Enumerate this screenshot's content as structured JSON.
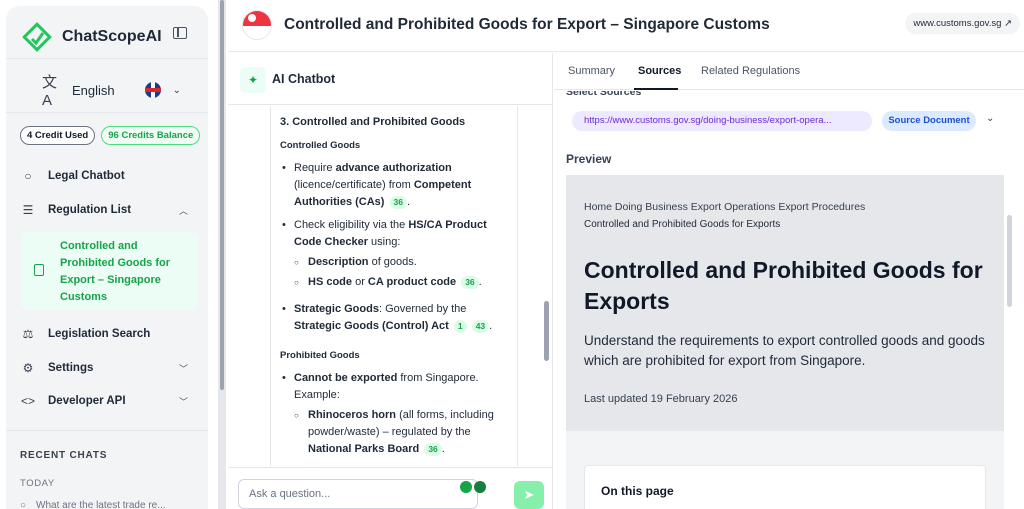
{
  "brand": {
    "name": "ChatScopeAI"
  },
  "language": {
    "label": "English"
  },
  "credits": {
    "used": "4 Credit Used",
    "balance": "96 Credits Balance"
  },
  "nav": {
    "legal_chatbot": "Legal Chatbot",
    "regulation_list": "Regulation List",
    "active_regulation": "Controlled and Prohibited Goods for Export – Singapore Customs",
    "legislation_search": "Legislation Search",
    "settings": "Settings",
    "developer_api": "Developer API"
  },
  "recent": {
    "heading": "RECENT CHATS",
    "today": "TODAY",
    "first_chat": "What are the latest trade re..."
  },
  "header": {
    "title": "Controlled and Prohibited Goods for Export – Singapore Customs",
    "url": "www.customs.gov.sg"
  },
  "chat": {
    "title": "AI Chatbot",
    "section_heading": "3. Controlled and Prohibited Goods",
    "controlled_heading": "Controlled Goods",
    "b1_pre": "Require ",
    "b1_bold1": "advance authorization",
    "b1_mid": " (licence/certificate) from ",
    "b1_bold2": "Competent Authorities (CAs)",
    "b1_cite": "36",
    "b2_pre": "Check eligibility via the ",
    "b2_bold": "HS/CA Product Code Checker",
    "b2_post": " using:",
    "b2a_bold": "Description",
    "b2a_post": " of goods.",
    "b2b_bold1": "HS code",
    "b2b_mid": " or ",
    "b2b_bold2": "CA product code",
    "b2b_cite": "36",
    "b3_bold": "Strategic Goods",
    "b3_mid": ": Governed by the ",
    "b3_bold2": "Strategic Goods (Control) Act",
    "b3_cite1": "1",
    "b3_cite2": "43",
    "prohibited_heading": "Prohibited Goods",
    "p1_bold": "Cannot be exported",
    "p1_post": " from Singapore. Example:",
    "p1a_bold": "Rhinoceros horn",
    "p1a_mid": " (all forms, including powder/waste) – regulated by the ",
    "p1a_bold2": "National Parks Board",
    "p1a_cite": "36",
    "input_placeholder": "Ask a question..."
  },
  "tabs": {
    "summary": "Summary",
    "sources": "Sources",
    "related": "Related Regulations"
  },
  "sources": {
    "select_label": "Select Sources",
    "url": "https://www.customs.gov.sg/doing-business/export-opera...",
    "doc_label": "Source Document",
    "preview_label": "Preview"
  },
  "preview": {
    "breadcrumb": "Home Doing Business Export Operations Export Procedures",
    "current": "Controlled and Prohibited Goods for Exports",
    "title": "Controlled and Prohibited Goods for Exports",
    "desc": "Understand the requirements to export controlled goods and goods which are prohibited for export from Singapore.",
    "updated": "Last updated 19 February 2026",
    "on_page": "On this page"
  }
}
